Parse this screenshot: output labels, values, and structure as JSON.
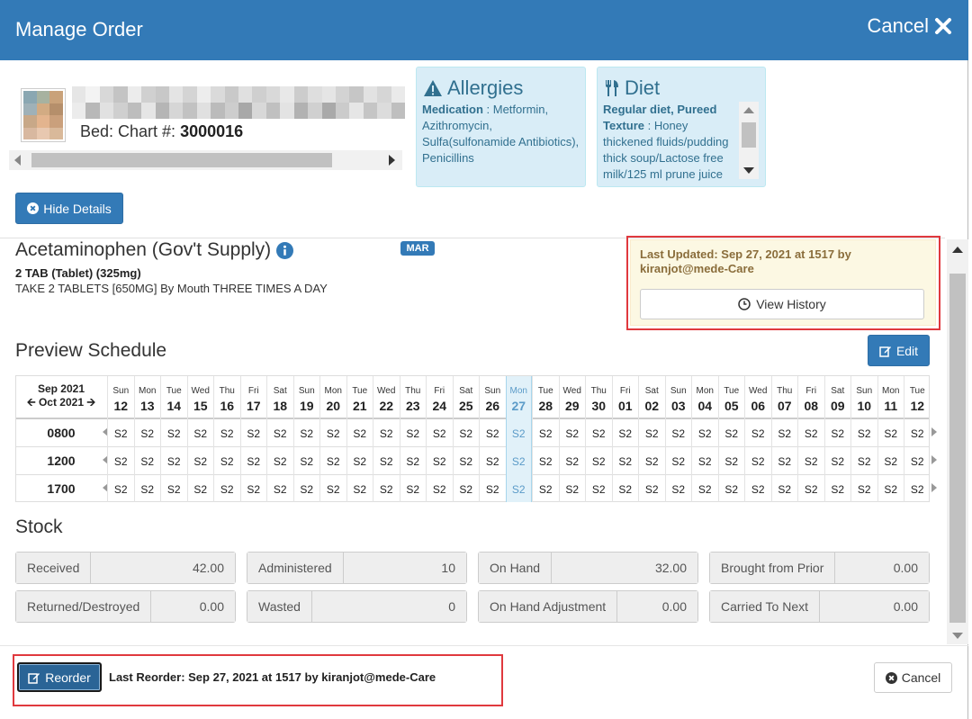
{
  "header": {
    "title": "Manage Order",
    "cancel_label": "Cancel"
  },
  "patient": {
    "bed_label": "Bed: Chart #:",
    "chart_number": "3000016"
  },
  "allergies": {
    "title": "Allergies",
    "medication_label": "Medication",
    "medication_text": " : Metformin, Azithromycin, Sulfa(sulfonamide Antibiotics), Penicillins"
  },
  "diet": {
    "title": "Diet",
    "bold_text": "Regular diet, Pureed Texture",
    "text": " : Honey thickened fluids/pudding thick soup/Lactose free milk/125 ml prune juice"
  },
  "hide_details_label": "Hide Details",
  "medication": {
    "name": "Acetaminophen (Gov't Supply)",
    "badge": "MAR",
    "dose": "2 TAB (Tablet) (325mg)",
    "instructions": "TAKE 2 TABLETS [650MG] By Mouth THREE TIMES A DAY"
  },
  "last_updated": {
    "text": "Last Updated: Sep 27, 2021 at 1517 by kiranjot@mede-Care",
    "view_history_label": "View History"
  },
  "schedule": {
    "title": "Preview Schedule",
    "edit_label": "Edit",
    "month_line1": "Sep 2021",
    "month_line2": "Oct 2021",
    "today_index": 15,
    "days": [
      {
        "name": "Sun",
        "num": "12"
      },
      {
        "name": "Mon",
        "num": "13"
      },
      {
        "name": "Tue",
        "num": "14"
      },
      {
        "name": "Wed",
        "num": "15"
      },
      {
        "name": "Thu",
        "num": "16"
      },
      {
        "name": "Fri",
        "num": "17"
      },
      {
        "name": "Sat",
        "num": "18"
      },
      {
        "name": "Sun",
        "num": "19"
      },
      {
        "name": "Mon",
        "num": "20"
      },
      {
        "name": "Tue",
        "num": "21"
      },
      {
        "name": "Wed",
        "num": "22"
      },
      {
        "name": "Thu",
        "num": "23"
      },
      {
        "name": "Fri",
        "num": "24"
      },
      {
        "name": "Sat",
        "num": "25"
      },
      {
        "name": "Sun",
        "num": "26"
      },
      {
        "name": "Mon",
        "num": "27"
      },
      {
        "name": "Tue",
        "num": "28"
      },
      {
        "name": "Wed",
        "num": "29"
      },
      {
        "name": "Thu",
        "num": "30"
      },
      {
        "name": "Fri",
        "num": "01"
      },
      {
        "name": "Sat",
        "num": "02"
      },
      {
        "name": "Sun",
        "num": "03"
      },
      {
        "name": "Mon",
        "num": "04"
      },
      {
        "name": "Tue",
        "num": "05"
      },
      {
        "name": "Wed",
        "num": "06"
      },
      {
        "name": "Thu",
        "num": "07"
      },
      {
        "name": "Fri",
        "num": "08"
      },
      {
        "name": "Sat",
        "num": "09"
      },
      {
        "name": "Sun",
        "num": "10"
      },
      {
        "name": "Mon",
        "num": "11"
      },
      {
        "name": "Tue",
        "num": "12"
      }
    ],
    "times": [
      "0800",
      "1200",
      "1700"
    ],
    "cell_value": "S2"
  },
  "stock": {
    "title": "Stock",
    "items": [
      {
        "label": "Received",
        "value": "42.00"
      },
      {
        "label": "Administered",
        "value": "10"
      },
      {
        "label": "On Hand",
        "value": "32.00"
      },
      {
        "label": "Brought from Prior",
        "value": "0.00"
      },
      {
        "label": "Returned/Destroyed",
        "value": "0.00"
      },
      {
        "label": "Wasted",
        "value": "0"
      },
      {
        "label": "On Hand Adjustment",
        "value": "0.00"
      },
      {
        "label": "Carried To Next",
        "value": "0.00"
      }
    ]
  },
  "footer": {
    "reorder_label": "Reorder",
    "last_reorder": "Last Reorder: Sep 27, 2021 at 1517 by kiranjot@mede-Care",
    "cancel_label": "Cancel"
  },
  "colors": {
    "primary": "#337ab7",
    "info_bg": "#d9edf7",
    "warning_bg": "#fcf8e3",
    "highlight": "#e0393e"
  }
}
